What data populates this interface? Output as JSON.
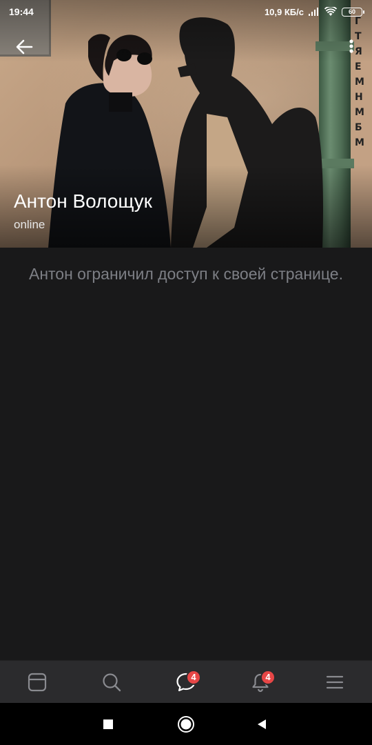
{
  "status_bar": {
    "time": "19:44",
    "network_speed": "10,9 КБ/с",
    "battery": "60"
  },
  "icons": {
    "back": "arrow-left-icon",
    "menu": "more-vertical-icon",
    "news": "newsfeed-icon",
    "search": "search-icon",
    "messages": "chat-bubble-icon",
    "notifications": "bell-icon",
    "more": "hamburger-menu-icon"
  },
  "profile": {
    "name": "Антон Волощук",
    "status": "online"
  },
  "content": {
    "restricted_message": "Антон ограничил доступ к своей странице."
  },
  "bottom_nav": {
    "messages_badge": "4",
    "notifications_badge": "4"
  },
  "colors": {
    "background": "#19191a",
    "nav_background": "#2b2b2d",
    "badge": "#e64646",
    "muted_text": "#7d7f85"
  }
}
